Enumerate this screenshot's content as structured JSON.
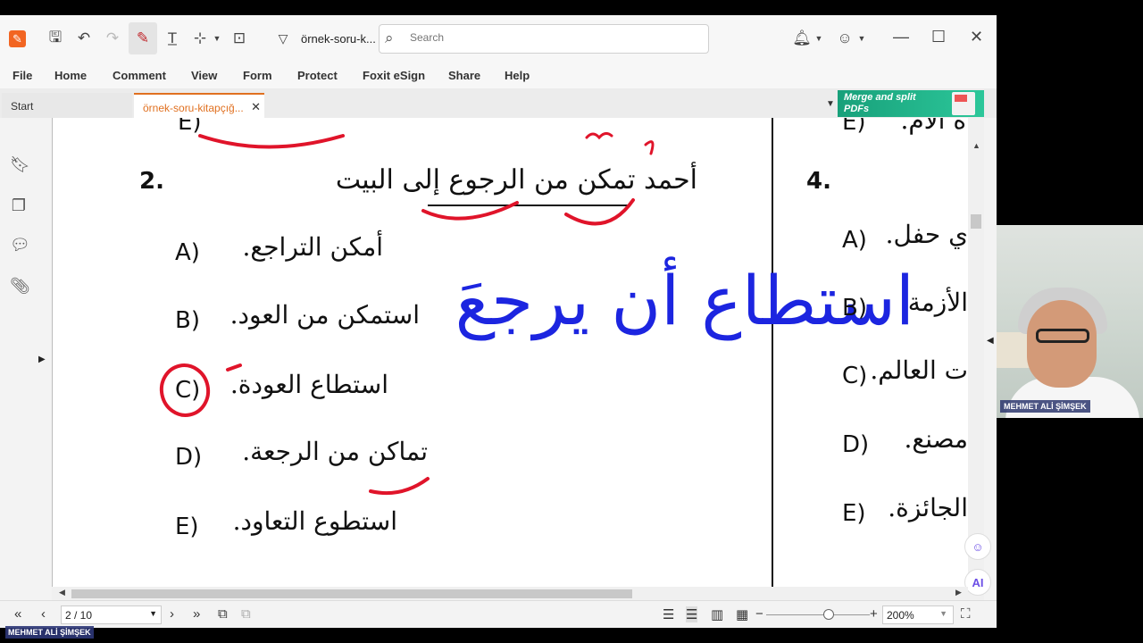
{
  "app": {
    "doc_title": "örnek-soru-k...",
    "search_placeholder": "Search"
  },
  "menu": [
    "File",
    "Home",
    "Comment",
    "View",
    "Form",
    "Protect",
    "Foxit eSign",
    "Share",
    "Help"
  ],
  "tabs": {
    "start": "Start",
    "document": "örnek-soru-kitapçığ...",
    "ad_text": "Merge and split PDFs"
  },
  "document": {
    "top_fragment": "E)",
    "question2": {
      "number": "2.",
      "stem": "أحمد تمكن من الرجوع إلى البيت",
      "options": [
        {
          "letter": "A)",
          "text": "أمكن التراجع."
        },
        {
          "letter": "B)",
          "text": "استمكن من العود."
        },
        {
          "letter": "C)",
          "text": "استطاع العودة."
        },
        {
          "letter": "D)",
          "text": "تماكن من الرجعة."
        },
        {
          "letter": "E)",
          "text": "استطوع التعاود."
        }
      ]
    },
    "annotation": "استطاع أن يرجعَ",
    "question4": {
      "number": "4.",
      "top_fragment_letter": "E)",
      "top_fragment_text": "ة الأم.",
      "options": [
        {
          "letter": "A)",
          "text": "ي حفل."
        },
        {
          "letter": "B)",
          "text": "الأزمة"
        },
        {
          "letter": "C)",
          "text": "ت العالم."
        },
        {
          "letter": "D)",
          "text": "مصنع."
        },
        {
          "letter": "E)",
          "text": "الجائزة."
        }
      ]
    }
  },
  "status": {
    "page": "2 / 10",
    "zoom": "200%",
    "zoom_level": 0.6
  },
  "webcam": {
    "name": "MEHMET ALİ ŞİMŞEK",
    "bottom_name": "MEHMET ALİ ŞİMŞEK"
  },
  "colors": {
    "accent": "#f26522",
    "annotation_blue": "#1c25e0",
    "annotation_red": "#e0142a"
  }
}
